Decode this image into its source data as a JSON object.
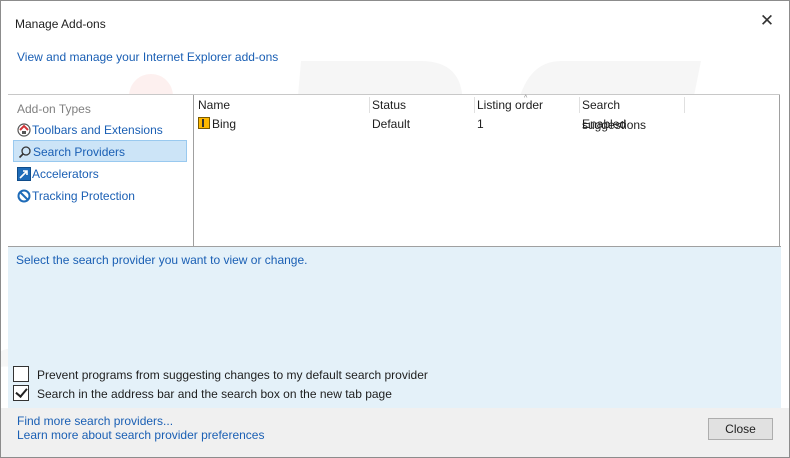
{
  "window": {
    "title": "Manage Add-ons",
    "close_glyph": "✕"
  },
  "header": {
    "link_text": "View and manage your Internet Explorer add-ons"
  },
  "sidebar": {
    "title": "Add-on Types",
    "items": [
      {
        "label": "Toolbars and Extensions",
        "icon": "toolbars-extensions-icon",
        "selected": false
      },
      {
        "label": "Search Providers",
        "icon": "search-magnifier-icon",
        "selected": true
      },
      {
        "label": "Accelerators",
        "icon": "accelerator-arrow-icon",
        "selected": false
      },
      {
        "label": "Tracking Protection",
        "icon": "blocked-circle-icon",
        "selected": false
      }
    ]
  },
  "table": {
    "columns": [
      "Name",
      "Status",
      "Listing order",
      "Search suggestions"
    ],
    "rows": [
      {
        "name": "Bing",
        "status": "Default",
        "listing_order": "1",
        "search_suggestions": "Enabled",
        "icon": "bing-icon"
      }
    ]
  },
  "details": {
    "prompt": "Select the search provider you want to view or change.",
    "options": [
      {
        "label": "Prevent programs from suggesting changes to my default search provider",
        "checked": false
      },
      {
        "label": "Search in the address bar and the search box on the new tab page",
        "checked": true
      }
    ]
  },
  "footer": {
    "links": [
      "Find more search providers...",
      "Learn more about search provider preferences"
    ],
    "close_label": "Close"
  },
  "colors": {
    "link": "#1a5fb4",
    "selection": "#cce4f7",
    "details_bg": "#e4f1f9",
    "footer_bg": "#f0f0f0"
  }
}
